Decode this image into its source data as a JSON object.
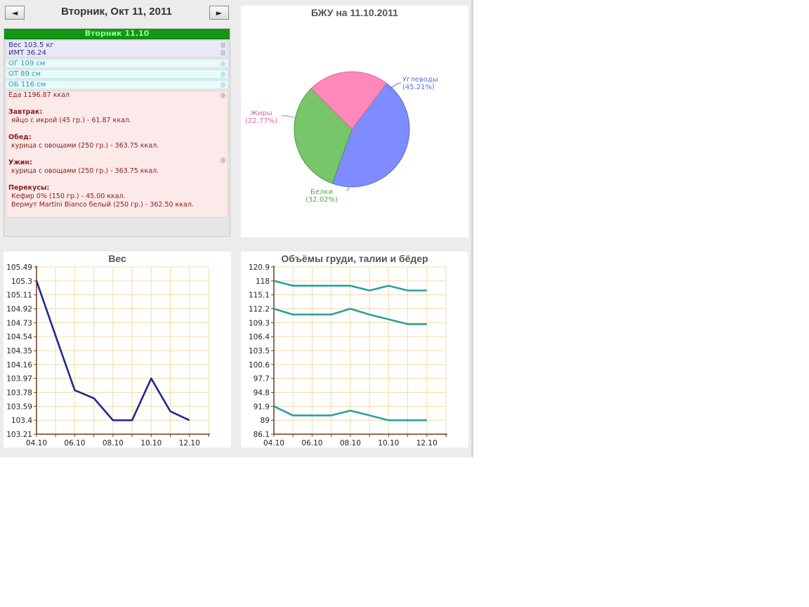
{
  "nav": {
    "prev_icon": "left-arrow-icon",
    "next_icon": "right-arrow-icon",
    "prev_label": "◄",
    "next_label": "►",
    "date_title": "Вторник, Окт 11, 2011"
  },
  "day": {
    "header": "Вторник 11.10",
    "weight": "Вес 103.5 кг",
    "bmi": "ИМТ 36.24",
    "chest": "ОГ 109 см",
    "waist": "ОТ 89 см",
    "hips": "ОБ 116 см",
    "food_total": "Еда 1196.87 ккал",
    "meals": [
      {
        "title": "Завтрак:",
        "items": [
          "яйцо с икрой (45 гр.) - 61.87 ккал."
        ]
      },
      {
        "title": "Обед:",
        "items": [
          "курица с овощами (250 гр.) - 363.75 ккал."
        ]
      },
      {
        "title": "Ужин:",
        "items": [
          "курица с овощами (250 гр.) - 363.75 ккал."
        ]
      },
      {
        "title": "Перекусы:",
        "items": [
          "Кефир 0% (150 гр.) - 45.00 ккал.",
          "Вермут Martini Bianco белый (250 гр.) - 362.50 ккал."
        ]
      }
    ]
  },
  "colors": {
    "header_green": "#149614",
    "weight_line": "#1f2a8c",
    "measure_line": "#2aa0a0",
    "pie_carbs": "#7f8cff",
    "pie_protein": "#77c66a",
    "pie_fat": "#ff88bb"
  },
  "chart_data": [
    {
      "type": "pie",
      "title": "БЖУ на 11.10.2011",
      "slices": [
        {
          "name": "Углеводы",
          "value": 45.21,
          "label": "(45.21%)",
          "color": "#7f8cff"
        },
        {
          "name": "Белки",
          "value": 32.02,
          "label": "(32.02%)",
          "color": "#77c66a"
        },
        {
          "name": "Жиры",
          "value": 22.77,
          "label": "(22.77%)",
          "color": "#ff88bb"
        }
      ]
    },
    {
      "type": "line",
      "title": "Вес",
      "ylim": [
        103.21,
        105.49
      ],
      "yticks": [
        "105.49",
        "105.3",
        "105.11",
        "104.92",
        "104.73",
        "104.54",
        "104.35",
        "104.16",
        "103.97",
        "103.78",
        "103.59",
        "103.4",
        "103.21"
      ],
      "xlim": [
        4,
        13
      ],
      "xticks": [
        {
          "v": 4,
          "label": "04.10"
        },
        {
          "v": 6,
          "label": "06.10"
        },
        {
          "v": 8,
          "label": "08.10"
        },
        {
          "v": 10,
          "label": "10.10"
        },
        {
          "v": 12,
          "label": "12.10"
        }
      ],
      "series": [
        {
          "x": [
            4,
            5,
            6,
            7,
            8,
            9,
            10,
            11,
            12
          ],
          "values": [
            105.3,
            104.55,
            103.81,
            103.7,
            103.4,
            103.4,
            103.97,
            103.52,
            103.4
          ]
        }
      ]
    },
    {
      "type": "line",
      "title": "Объёмы груди, талии и бёдер",
      "ylim": [
        86.1,
        120.9
      ],
      "yticks": [
        "120.9",
        "118",
        "115.1",
        "112.2",
        "109.3",
        "106.4",
        "103.5",
        "100.6",
        "97.7",
        "94.8",
        "91.9",
        "89",
        "86.1"
      ],
      "xlim": [
        4,
        13
      ],
      "xticks": [
        {
          "v": 4,
          "label": "04.10"
        },
        {
          "v": 6,
          "label": "06.10"
        },
        {
          "v": 8,
          "label": "08.10"
        },
        {
          "v": 10,
          "label": "10.10"
        },
        {
          "v": 12,
          "label": "12.10"
        }
      ],
      "series": [
        {
          "x": [
            4,
            5,
            6,
            7,
            8,
            9,
            10,
            11,
            12
          ],
          "values": [
            118,
            117,
            117,
            117,
            117,
            116,
            117,
            116,
            116
          ]
        },
        {
          "x": [
            4,
            5,
            6,
            7,
            8,
            9,
            10,
            11,
            12
          ],
          "values": [
            112.2,
            111,
            111,
            111,
            112.2,
            111,
            110,
            109,
            109
          ]
        },
        {
          "x": [
            4,
            5,
            6,
            7,
            8,
            9,
            10,
            11,
            12
          ],
          "values": [
            91.9,
            90,
            90,
            90,
            91,
            90,
            89,
            89,
            89
          ]
        }
      ]
    }
  ]
}
